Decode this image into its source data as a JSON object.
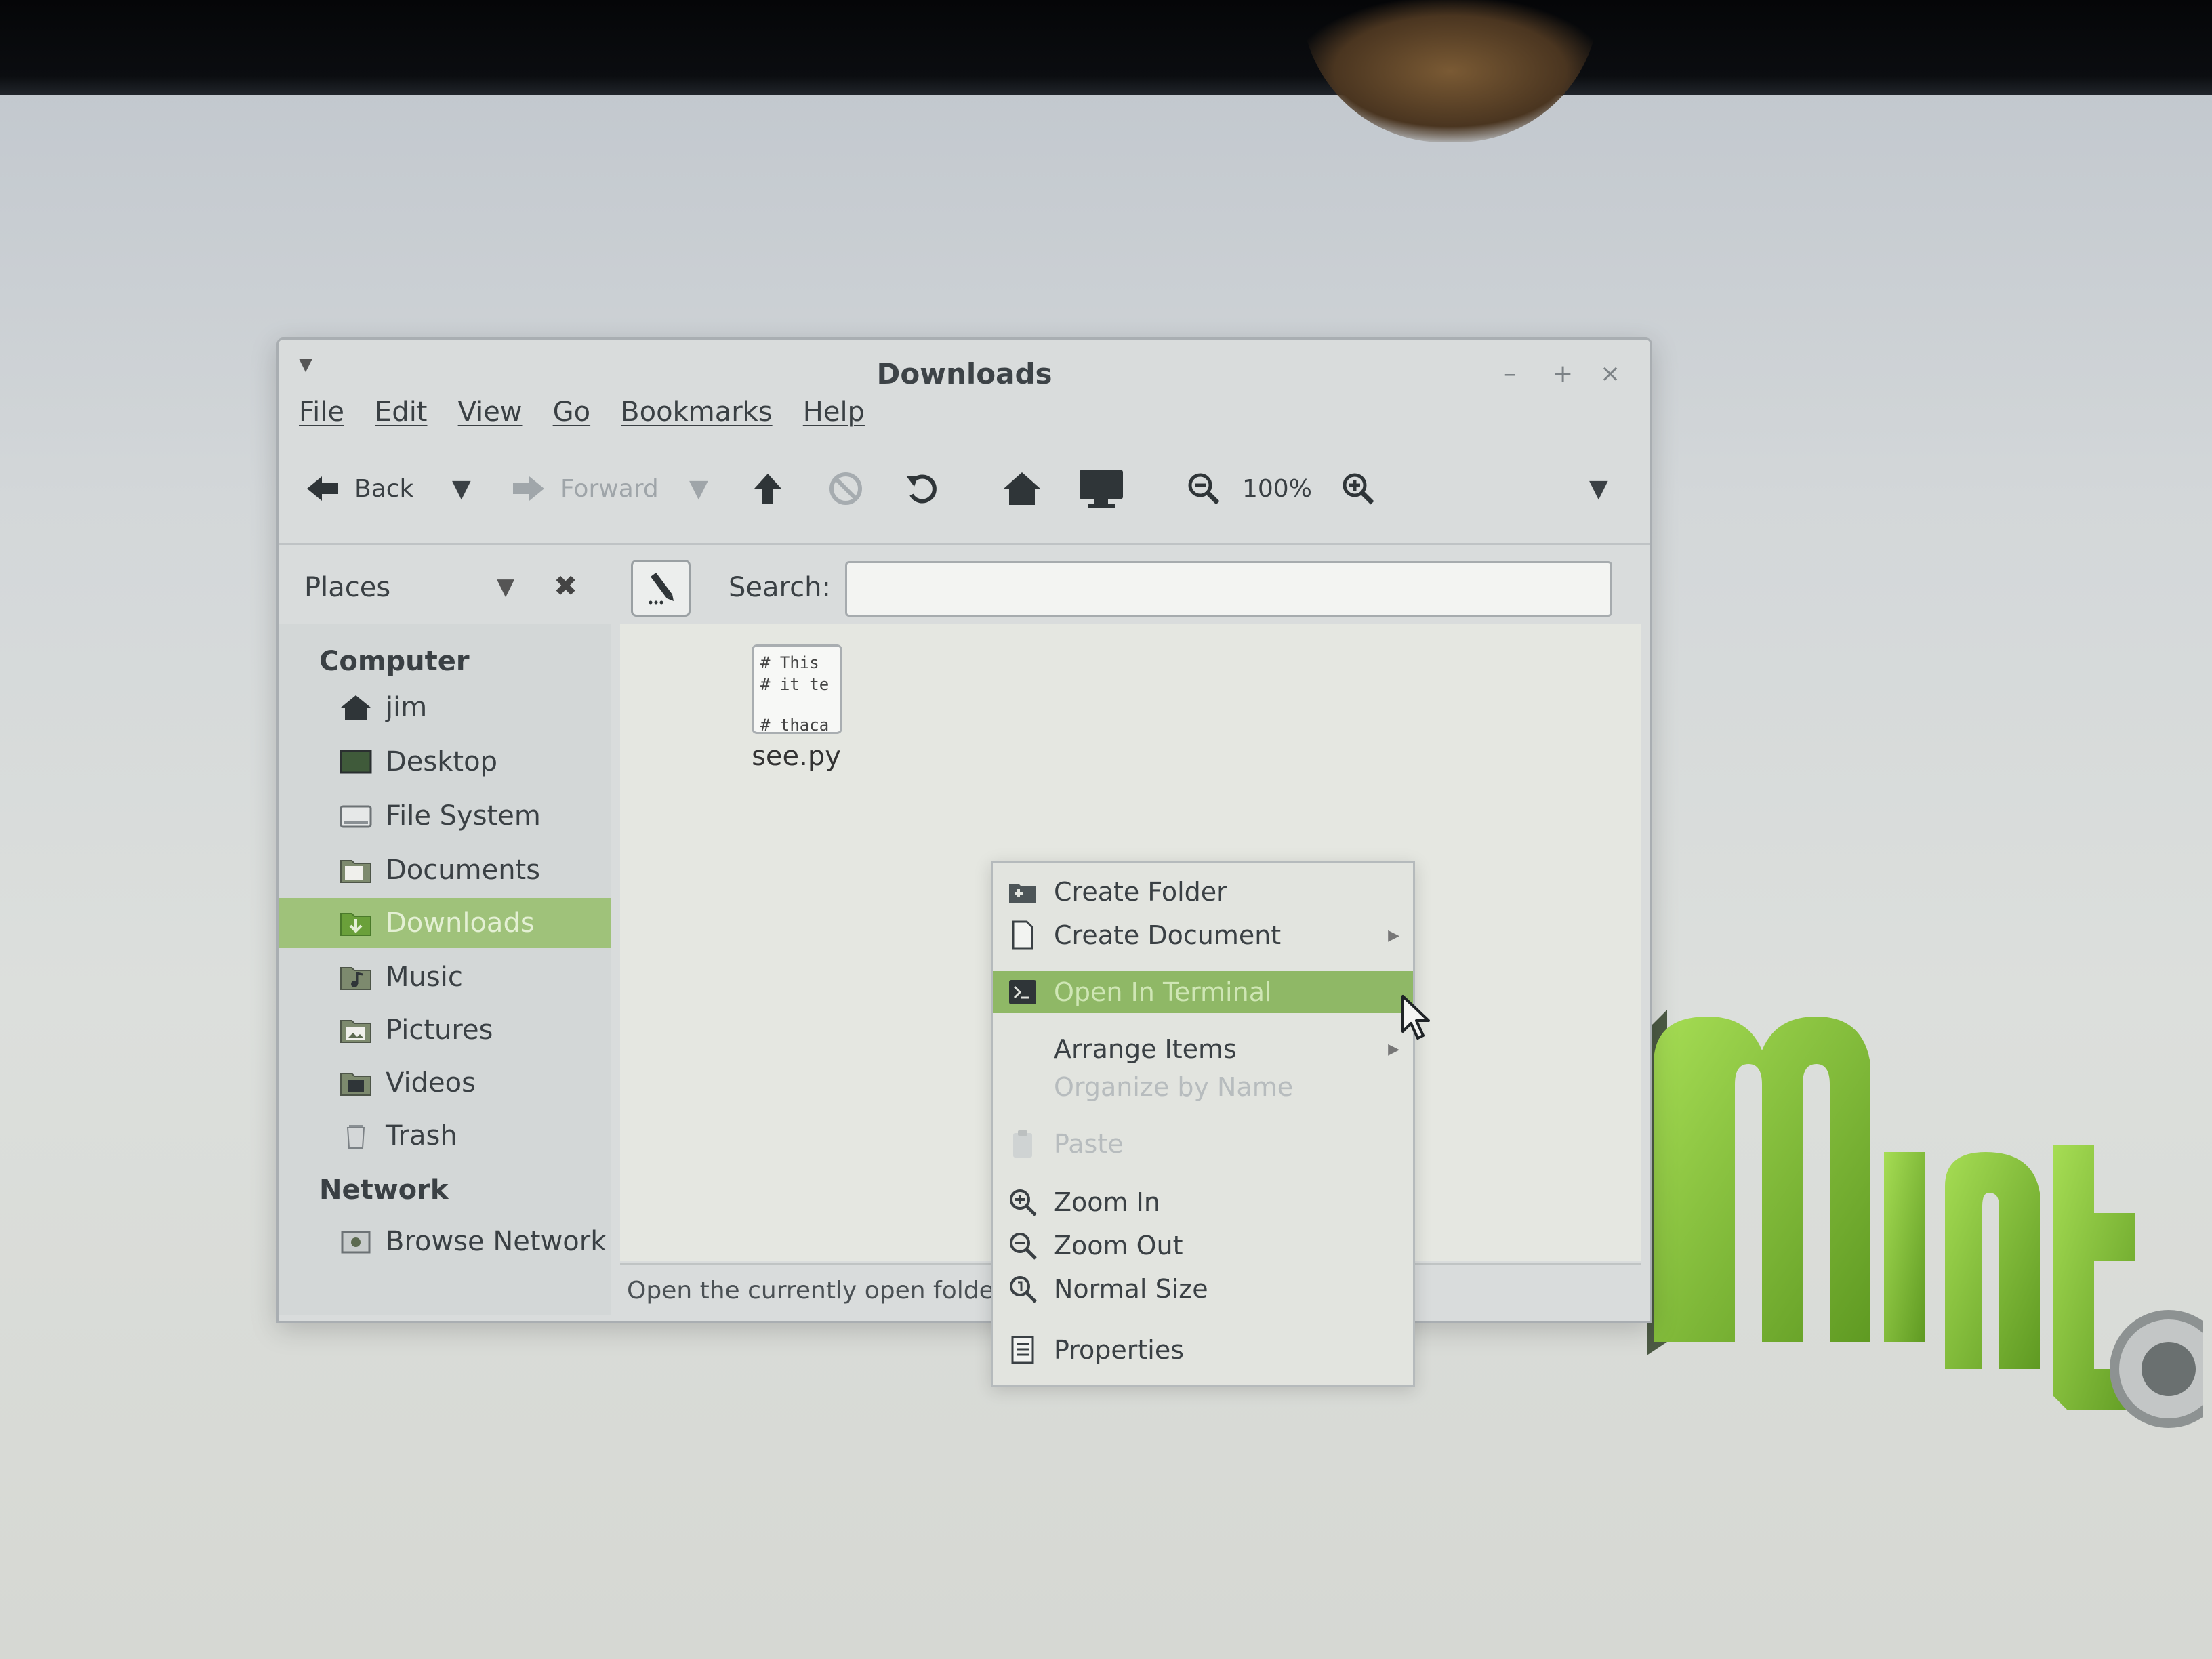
{
  "window": {
    "title": "Downloads",
    "controls": {
      "minimize": "–",
      "maximize": "+",
      "close": "×"
    }
  },
  "menubar": [
    "File",
    "Edit",
    "View",
    "Go",
    "Bookmarks",
    "Help"
  ],
  "toolbar": {
    "back": "Back",
    "forward": "Forward",
    "zoom": "100%"
  },
  "panebar": {
    "places": "Places",
    "search_label": "Search:",
    "search_value": ""
  },
  "sidebar": {
    "computer": "Computer",
    "items": [
      {
        "label": "jim",
        "icon": "home-icon"
      },
      {
        "label": "Desktop",
        "icon": "desktop-icon"
      },
      {
        "label": "File System",
        "icon": "drive-icon"
      },
      {
        "label": "Documents",
        "icon": "folder-icon"
      },
      {
        "label": "Downloads",
        "icon": "folder-download-icon",
        "selected": true
      },
      {
        "label": "Music",
        "icon": "folder-music-icon"
      },
      {
        "label": "Pictures",
        "icon": "folder-pictures-icon"
      },
      {
        "label": "Videos",
        "icon": "folder-videos-icon"
      },
      {
        "label": "Trash",
        "icon": "trash-icon"
      }
    ],
    "network": "Network",
    "network_items": [
      {
        "label": "Browse Network",
        "icon": "network-icon"
      }
    ]
  },
  "content": {
    "file": {
      "name": "see.py",
      "preview": [
        "# This",
        "# it te",
        "",
        "# thaca"
      ]
    }
  },
  "status": "Open the currently open folder",
  "context_menu": {
    "items": [
      {
        "label": "Create Folder",
        "icon": "new-folder-icon"
      },
      {
        "label": "Create Document",
        "icon": "new-document-icon",
        "submenu": true
      },
      {
        "label": "Open In Terminal",
        "icon": "terminal-icon",
        "highlighted": true
      },
      {
        "label": "Arrange Items",
        "submenu": true
      },
      {
        "label": "Organize by Name",
        "disabled": true
      },
      {
        "label": "Paste",
        "icon": "paste-icon",
        "disabled": true
      },
      {
        "label": "Zoom In",
        "icon": "zoom-in-icon"
      },
      {
        "label": "Zoom Out",
        "icon": "zoom-out-icon"
      },
      {
        "label": "Normal Size",
        "icon": "zoom-reset-icon"
      },
      {
        "label": "Properties",
        "icon": "properties-icon"
      }
    ]
  },
  "colors": {
    "selection": "#9fc27a",
    "menu_highlight": "#8fb866",
    "mint_green": "#7ec23a"
  }
}
